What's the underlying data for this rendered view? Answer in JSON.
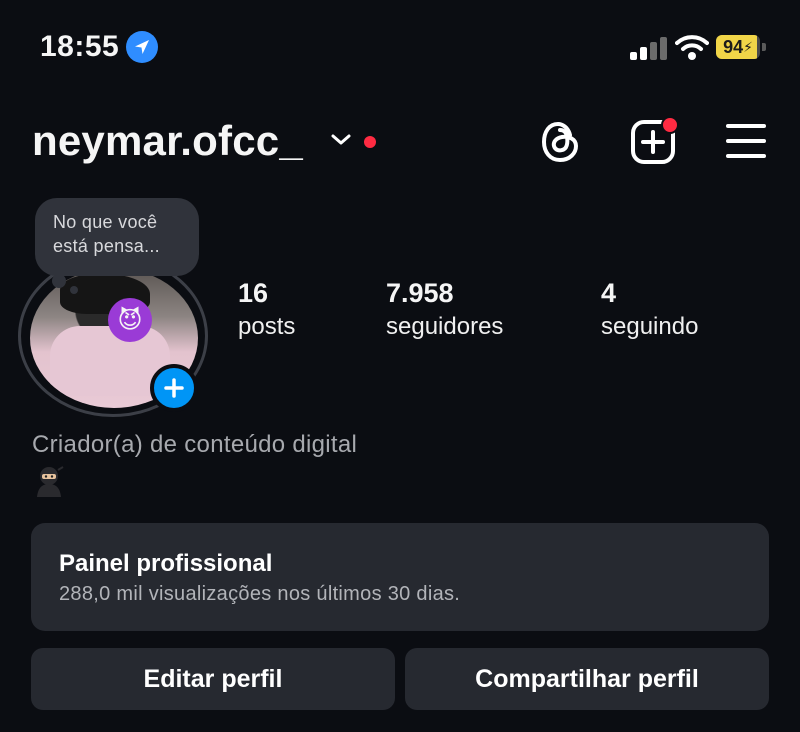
{
  "status_bar": {
    "time": "18:55",
    "location_icon": "location-arrow-icon",
    "signal_icon": "cellular-signal-icon",
    "wifi_icon": "wifi-icon",
    "battery_icon": "battery-charging-icon",
    "battery_level": "94",
    "battery_color": "#f1d548"
  },
  "header": {
    "username": "neymar.ofcc_",
    "switch_account_icon": "chevron-down-icon",
    "notification_dot_color": "#ff2b42",
    "threads_icon": "threads-icon",
    "create_icon": "plus-square-icon",
    "menu_icon": "hamburger-menu-icon"
  },
  "profile": {
    "note_placeholder": "No que você está pensa...",
    "avatar_add_icon": "plus-icon",
    "stats": [
      {
        "value": "16",
        "label": "posts"
      },
      {
        "value": "7.958",
        "label": "seguidores"
      },
      {
        "value": "4",
        "label": "seguindo"
      }
    ],
    "category": "Criador(a) de conteúdo digital",
    "bio_emoji": "🥷"
  },
  "professional_panel": {
    "title": "Painel profissional",
    "subtitle": "288,0 mil visualizações nos últimos 30 dias."
  },
  "actions": {
    "edit_label": "Editar perfil",
    "share_label": "Compartilhar perfil"
  },
  "colors": {
    "background": "#0b0d12",
    "card": "#262930",
    "accent_blue": "#0095f6"
  }
}
